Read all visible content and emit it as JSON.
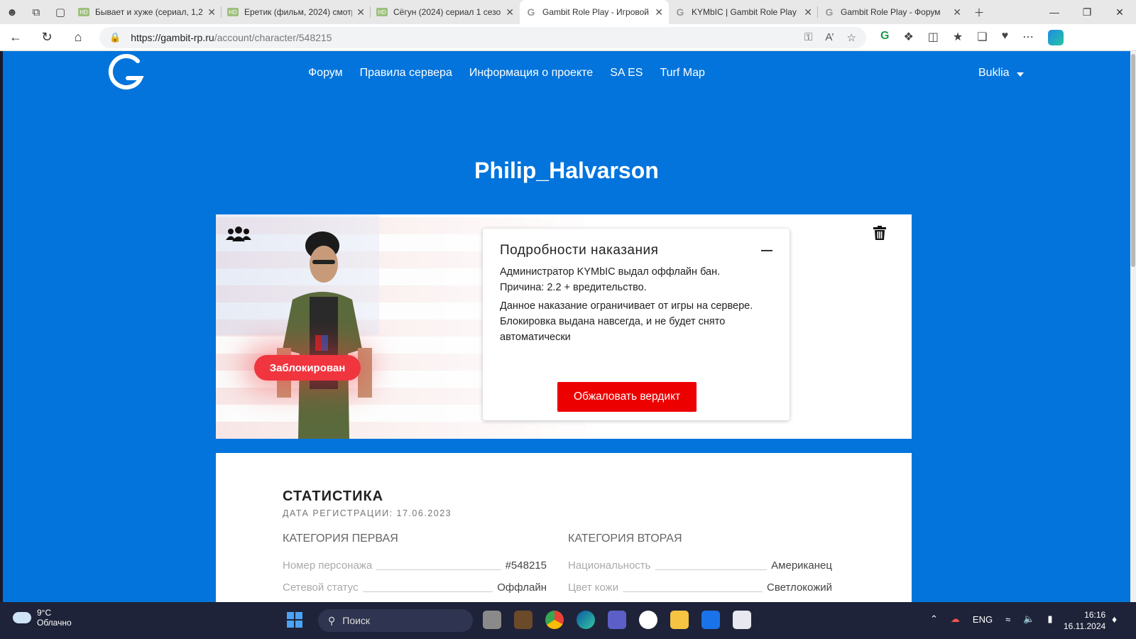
{
  "browser": {
    "tabs": [
      {
        "title": "Бывает и хуже (сериал, 1,2",
        "favicon": "HD"
      },
      {
        "title": "Еретик (фильм, 2024) смотр",
        "favicon": "HD"
      },
      {
        "title": "Сёгун (2024) сериал 1 сезо",
        "favicon": "HD"
      },
      {
        "title": "Gambit Role Play - Игровой",
        "favicon": "G",
        "active": true
      },
      {
        "title": "KYMbIC | Gambit Role Play",
        "favicon": "G"
      },
      {
        "title": "Gambit Role Play - Форум",
        "favicon": "G"
      }
    ],
    "url_host": "https://gambit-rp.ru",
    "url_path": "/account/character/548215"
  },
  "site": {
    "nav": [
      "Форум",
      "Правила сервера",
      "Информация о проекте",
      "SA ES",
      "Turf Map"
    ],
    "username": "Buklia",
    "accent_color": "#0274dc"
  },
  "character": {
    "name": "Philip_Halvarson",
    "status_badge": "Заблокирован",
    "punishment": {
      "title": "Подробности наказания",
      "line1": "Администратор KYMbIC выдал оффлайн бан.",
      "line2": "Причина: 2.2 + вредительство.",
      "line3": "Данное наказание ограничивает от игры на сервере. Блокировка выдана навсегда, и не будет снято автоматически",
      "appeal_button": "Обжаловать вердикт"
    }
  },
  "stats": {
    "title": "СТАТИСТИКА",
    "registration": "ДАТА РЕГИСТРАЦИИ: 17.06.2023",
    "category1": {
      "title": "КАТЕГОРИЯ ПЕРВАЯ",
      "rows": [
        {
          "label": "Номер персонажа",
          "value": "#548215"
        },
        {
          "label": "Сетевой статус",
          "value": "Оффлайн"
        }
      ]
    },
    "category2": {
      "title": "КАТЕГОРИЯ ВТОРАЯ",
      "rows": [
        {
          "label": "Национальность",
          "value": "Американец"
        },
        {
          "label": "Цвет кожи",
          "value": "Светлокожий"
        }
      ]
    }
  },
  "taskbar": {
    "temperature": "9°C",
    "weather": "Облачно",
    "search_placeholder": "Поиск",
    "language": "ENG",
    "time": "16:16",
    "date": "16.11.2024"
  }
}
